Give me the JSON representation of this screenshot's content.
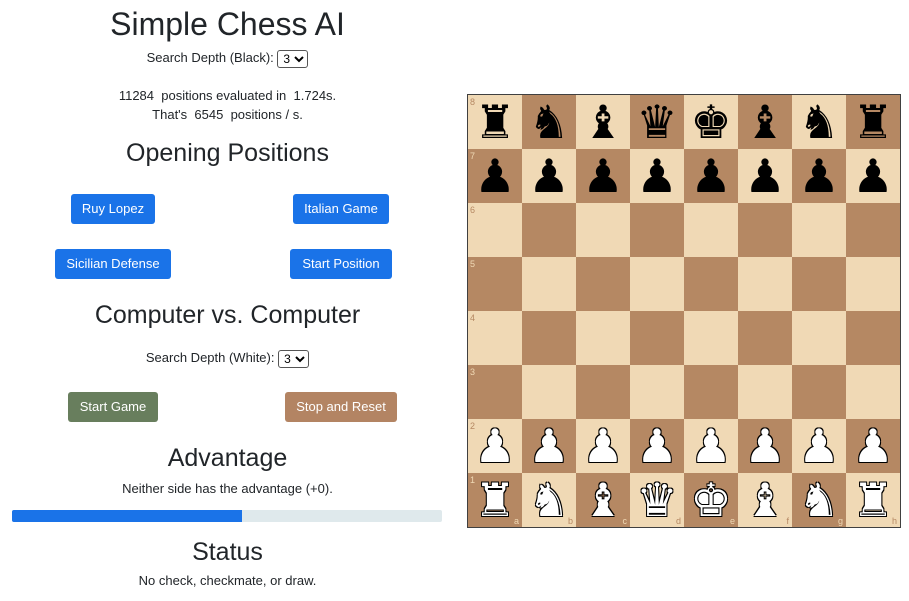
{
  "title": "Simple Chess AI",
  "search_black": {
    "label": "Search Depth (Black):",
    "value": "3",
    "options": [
      "3"
    ]
  },
  "stats": {
    "positions": "11284",
    "line1_mid": "positions evaluated in",
    "time": "1.724s.",
    "line2_pre": "That's",
    "per_second": "6545",
    "line2_post": "positions / s."
  },
  "openings": {
    "heading": "Opening Positions",
    "buttons": [
      "Ruy Lopez",
      "Italian Game",
      "Sicilian Defense",
      "Start Position"
    ]
  },
  "cvc": {
    "heading": "Computer vs. Computer",
    "search_white": {
      "label": "Search Depth (White):",
      "value": "3",
      "options": [
        "3"
      ]
    },
    "start_label": "Start Game",
    "stop_label": "Stop and Reset"
  },
  "advantage": {
    "heading": "Advantage",
    "text": "Neither side has the advantage (+0).",
    "fraction": 0.535
  },
  "status": {
    "heading": "Status",
    "text": "No check, checkmate, or draw."
  },
  "colors": {
    "light": "#f0d9b5",
    "dark": "#b58863",
    "blue": "#1a73e8",
    "green": "#687e5d",
    "tan": "#b38463"
  },
  "board": {
    "files": [
      "a",
      "b",
      "c",
      "d",
      "e",
      "f",
      "g",
      "h"
    ],
    "ranks": [
      "8",
      "7",
      "6",
      "5",
      "4",
      "3",
      "2",
      "1"
    ],
    "position": [
      [
        "bR",
        "bN",
        "bB",
        "bQ",
        "bK",
        "bB",
        "bN",
        "bR"
      ],
      [
        "bP",
        "bP",
        "bP",
        "bP",
        "bP",
        "bP",
        "bP",
        "bP"
      ],
      [
        "",
        "",
        "",
        "",
        "",
        "",
        "",
        ""
      ],
      [
        "",
        "",
        "",
        "",
        "",
        "",
        "",
        ""
      ],
      [
        "",
        "",
        "",
        "",
        "",
        "",
        "",
        ""
      ],
      [
        "",
        "",
        "",
        "",
        "",
        "",
        "",
        ""
      ],
      [
        "wP",
        "wP",
        "wP",
        "wP",
        "wP",
        "wP",
        "wP",
        "wP"
      ],
      [
        "wR",
        "wN",
        "wB",
        "wQ",
        "wK",
        "wB",
        "wN",
        "wR"
      ]
    ]
  }
}
